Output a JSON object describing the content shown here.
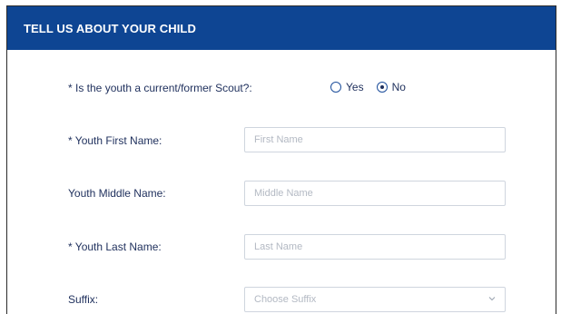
{
  "header": {
    "title": "TELL US ABOUT YOUR CHILD",
    "background_color": "#0e4593"
  },
  "scout_question": {
    "label": "* Is the youth a current/former Scout?:",
    "options": [
      {
        "label": "Yes",
        "selected": false
      },
      {
        "label": "No",
        "selected": true
      }
    ]
  },
  "fields": {
    "first_name": {
      "label": "* Youth First Name:",
      "placeholder": "First Name",
      "value": ""
    },
    "middle_name": {
      "label": "Youth Middle Name:",
      "placeholder": "Middle Name",
      "value": ""
    },
    "last_name": {
      "label": "* Youth Last Name:",
      "placeholder": "Last Name",
      "value": ""
    },
    "suffix": {
      "label": "Suffix:",
      "placeholder": "Choose Suffix",
      "icon": "chevron-down-icon"
    }
  }
}
